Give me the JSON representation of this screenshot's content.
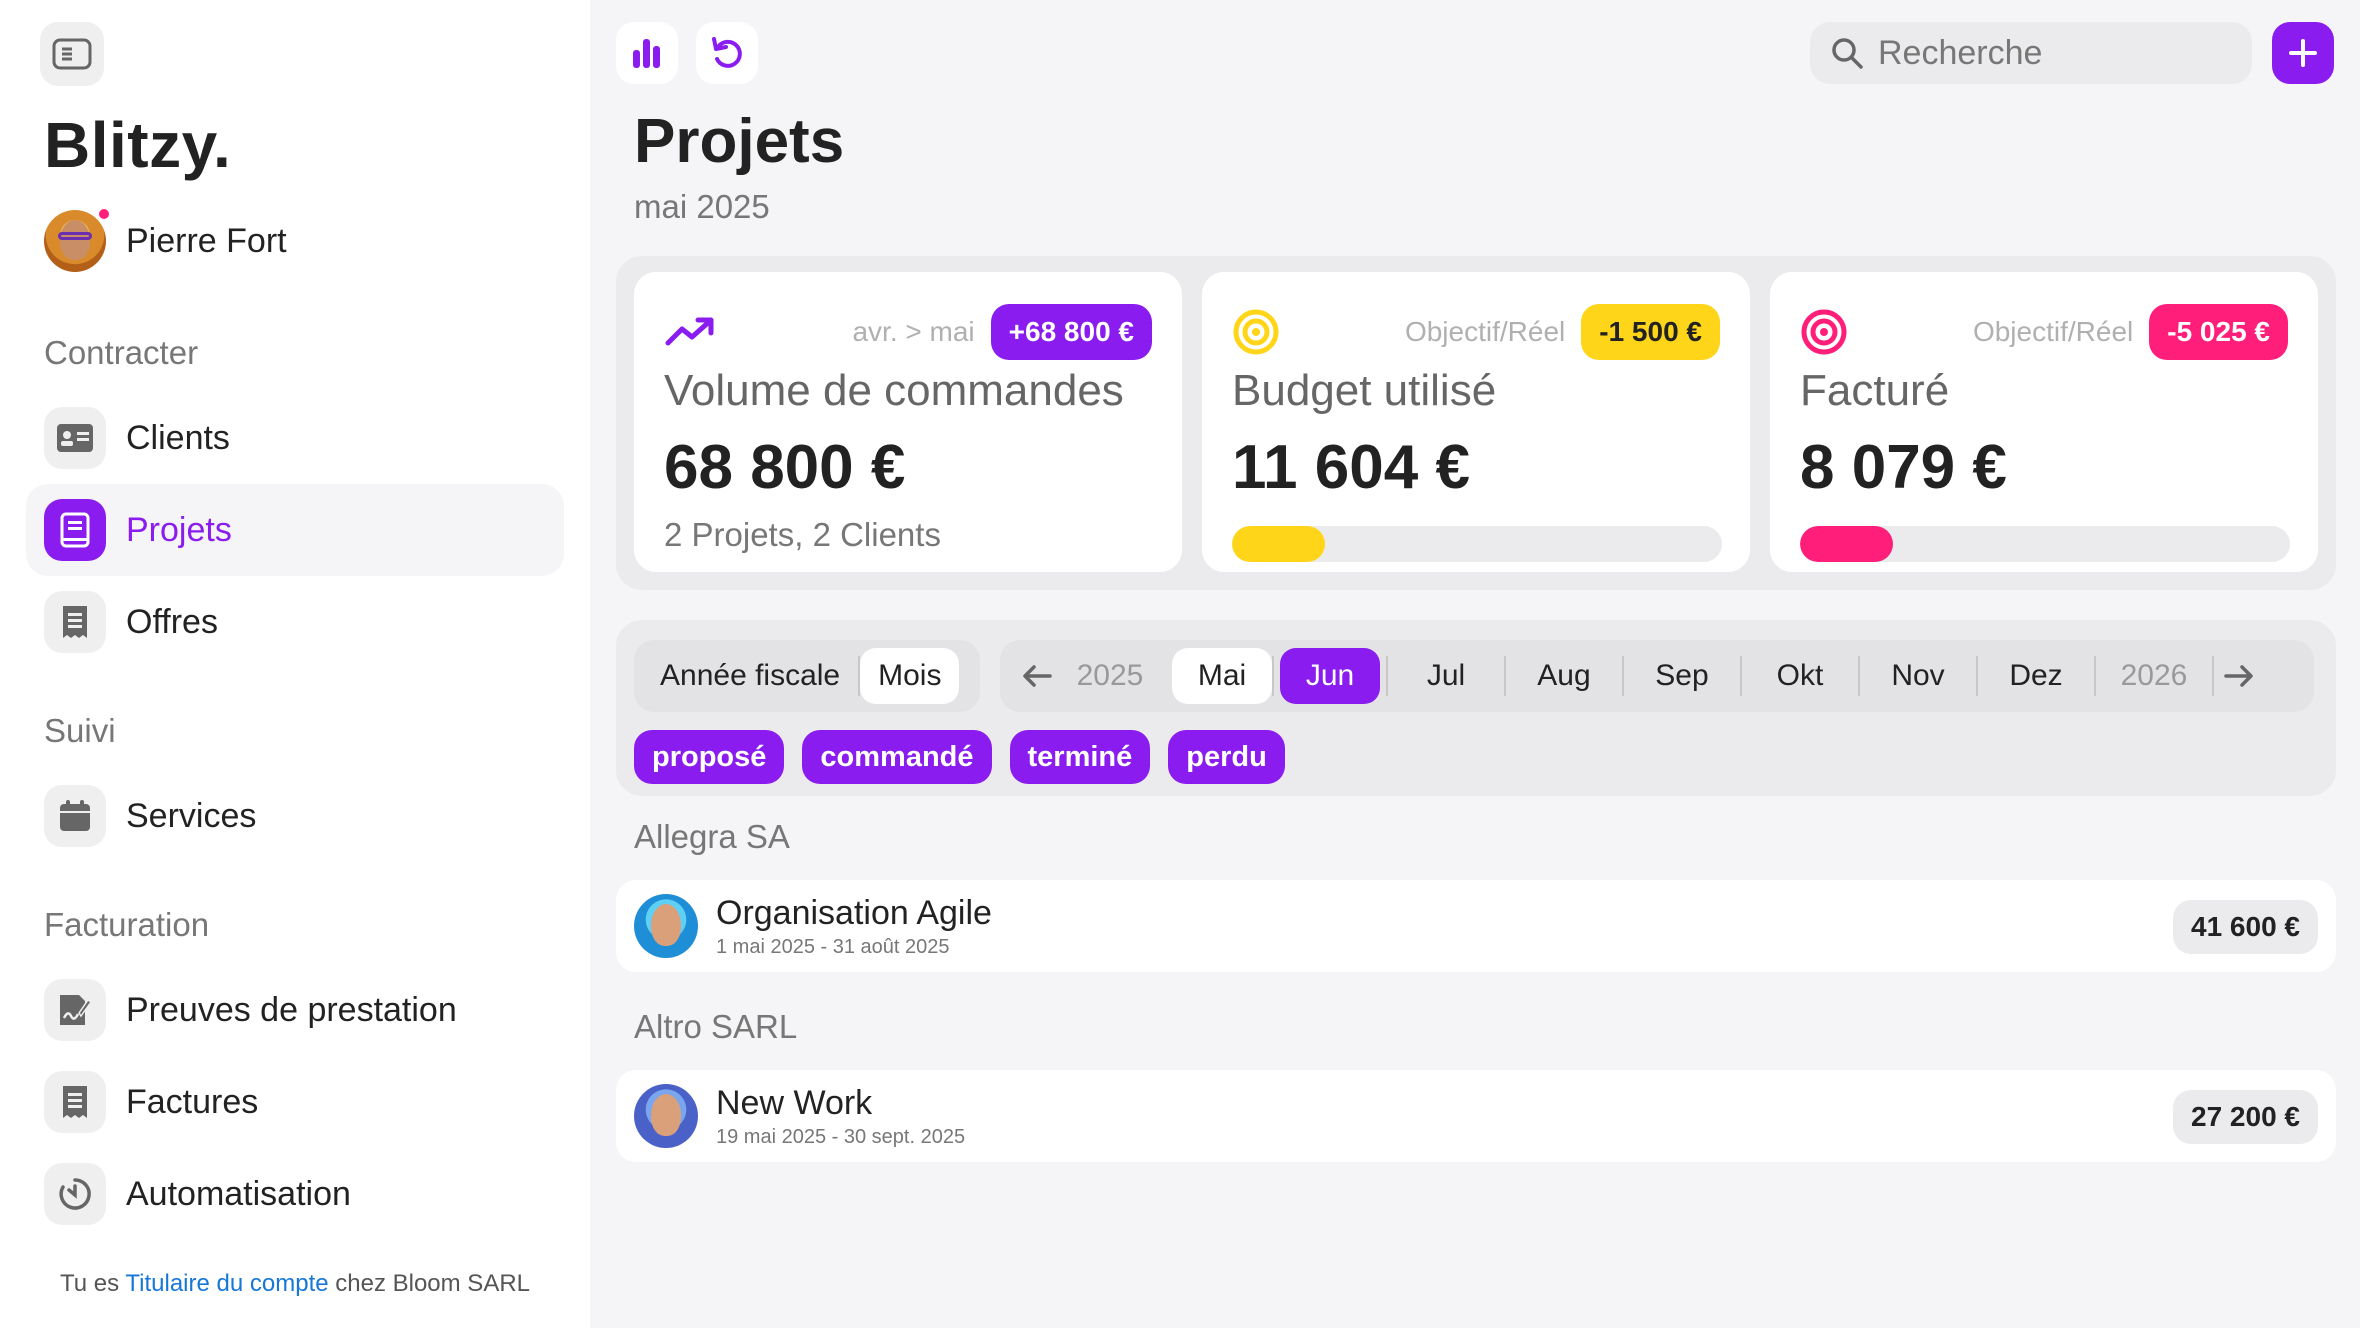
{
  "app": {
    "brand": "Blitzy."
  },
  "user": {
    "name": "Pierre Fort"
  },
  "sidebar": {
    "sections": [
      {
        "label": "Contracter"
      },
      {
        "label": "Suivi"
      },
      {
        "label": "Facturation"
      }
    ],
    "items": [
      {
        "label": "Clients",
        "icon": "id-card-icon"
      },
      {
        "label": "Projets",
        "icon": "notebook-icon",
        "active": true
      },
      {
        "label": "Offres",
        "icon": "receipt-icon"
      },
      {
        "label": "Services",
        "icon": "calendar-icon"
      },
      {
        "label": "Preuves de prestation",
        "icon": "signed-document-icon"
      },
      {
        "label": "Factures",
        "icon": "invoice-icon"
      },
      {
        "label": "Automatisation",
        "icon": "timer-icon"
      }
    ],
    "footer": {
      "prefix": "Tu es",
      "link": "Titulaire du compte",
      "suffix": "chez Bloom SARL"
    }
  },
  "header": {
    "search_placeholder": "Recherche",
    "accent": "#8a1cf0"
  },
  "page": {
    "title": "Projets",
    "subtitle": "mai 2025"
  },
  "kpis": [
    {
      "meta": "avr. > mai",
      "badge": "+68 800 €",
      "title": "Volume de commandes",
      "value": "68 800 €",
      "sub": "2 Projets, 2 Clients",
      "icon": "trend-up-icon",
      "color": "#8a1cf0"
    },
    {
      "meta": "Objectif/Réel",
      "badge": "-1 500 €",
      "title": "Budget utilisé",
      "value": "11 604 €",
      "progress": 0.19,
      "icon": "target-icon",
      "color": "#ffd51a"
    },
    {
      "meta": "Objectif/Réel",
      "badge": "-5 025 €",
      "title": "Facturé",
      "value": "8 079 €",
      "progress": 0.19,
      "icon": "target-icon",
      "color": "#ff1f7a"
    }
  ],
  "filters": {
    "period_modes": [
      "Année fiscale",
      "Mois"
    ],
    "period_mode_selected": "Mois",
    "year_prev": "2025",
    "year_next": "2026",
    "months": [
      "Mai",
      "Jun",
      "Jul",
      "Aug",
      "Sep",
      "Okt",
      "Nov",
      "Dez"
    ],
    "month_selected": "Jun",
    "statuses": [
      "proposé",
      "commandé",
      "terminé",
      "perdu"
    ]
  },
  "groups": [
    {
      "client": "Allegra SA",
      "projects": [
        {
          "title": "Organisation Agile",
          "dates": "1 mai 2025 - 31 août 2025",
          "amount": "41 600 €"
        }
      ]
    },
    {
      "client": "Altro SARL",
      "projects": [
        {
          "title": "New Work",
          "dates": "19 mai 2025 - 30 sept. 2025",
          "amount": "27 200 €"
        }
      ]
    }
  ]
}
